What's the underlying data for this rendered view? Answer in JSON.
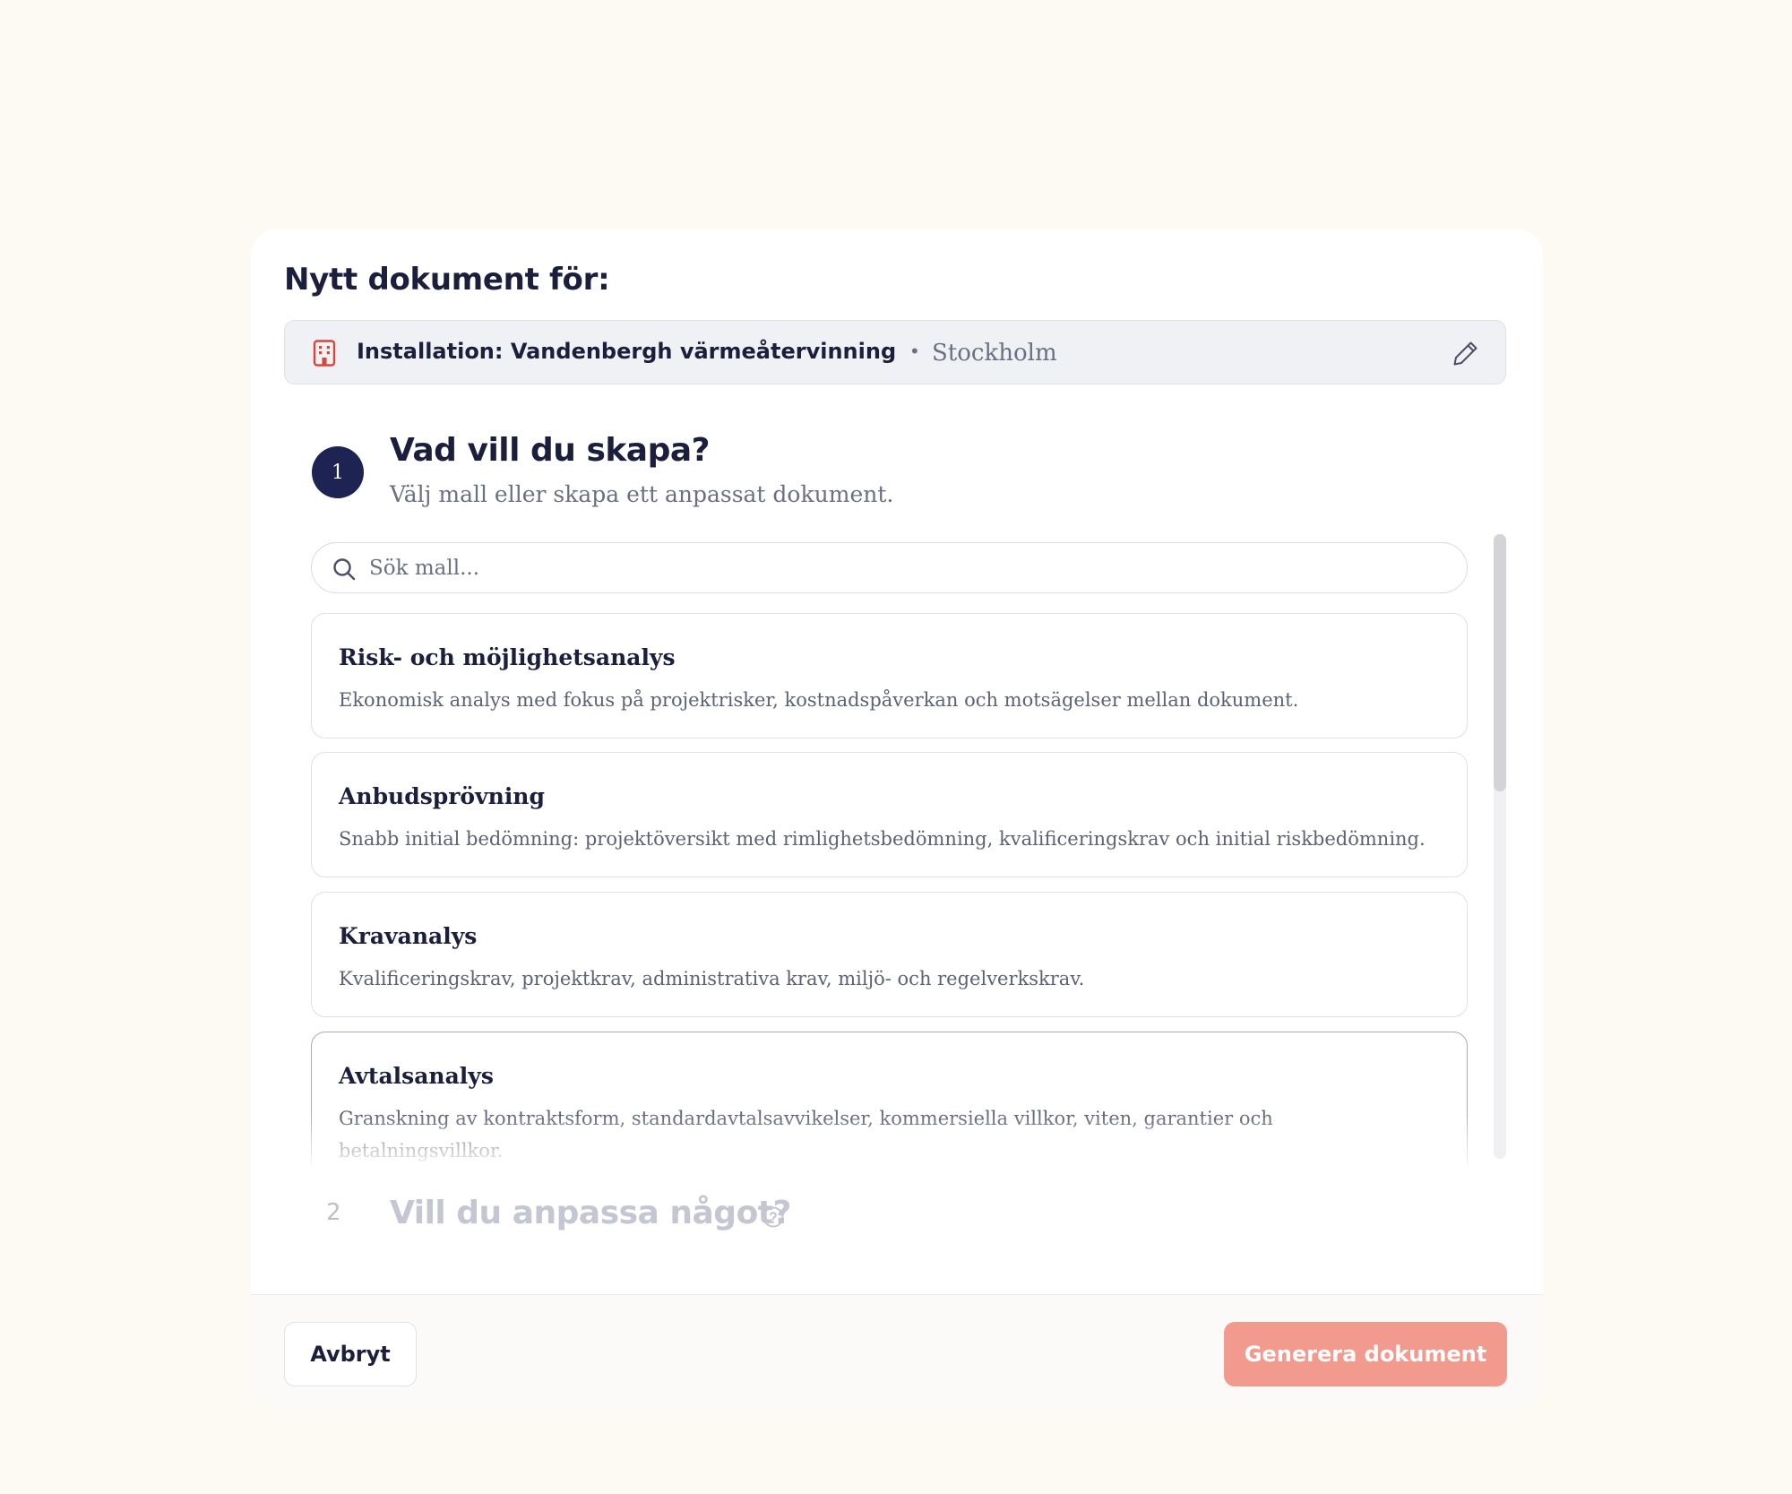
{
  "modal": {
    "title": "Nytt dokument för:",
    "target": {
      "name": "Installation: Vandenbergh värmeåtervinning",
      "separator": "•",
      "city": "Stockholm",
      "icon": "building-icon",
      "edit_icon": "pencil-icon"
    },
    "step1": {
      "number": "1",
      "title": "Vad vill du skapa?",
      "subtitle": "Välj mall eller skapa ett anpassat dokument."
    },
    "search": {
      "placeholder": "Sök mall...",
      "value": ""
    },
    "templates": [
      {
        "title": "Risk- och möjlighetsanalys",
        "description": "Ekonomisk analys med fokus på projektrisker, kostnadspåverkan och motsägelser mellan dokument."
      },
      {
        "title": "Anbudsprövning",
        "description": "Snabb initial bedömning: projektöversikt med rimlighetsbedömning, kvalificeringskrav och initial riskbedömning."
      },
      {
        "title": "Kravanalys",
        "description": "Kvalificeringskrav, projektkrav, administrativa krav, miljö- och regelverkskrav."
      },
      {
        "title": "Avtalsanalys",
        "description": "Granskning av kontraktsform, standardavtalsavvikelser, kommersiella villkor, viten, garantier och betalningsvillkor."
      }
    ],
    "step2": {
      "number": "2",
      "title": "Vill du anpassa något?",
      "icon": "help-circle-icon"
    },
    "footer": {
      "cancel_label": "Avbryt",
      "generate_label": "Generera dokument"
    }
  },
  "colors": {
    "background": "#fdf9f3",
    "navy": "#1d2353",
    "accent": "#f39a8e",
    "icon_red": "#d8453b"
  }
}
